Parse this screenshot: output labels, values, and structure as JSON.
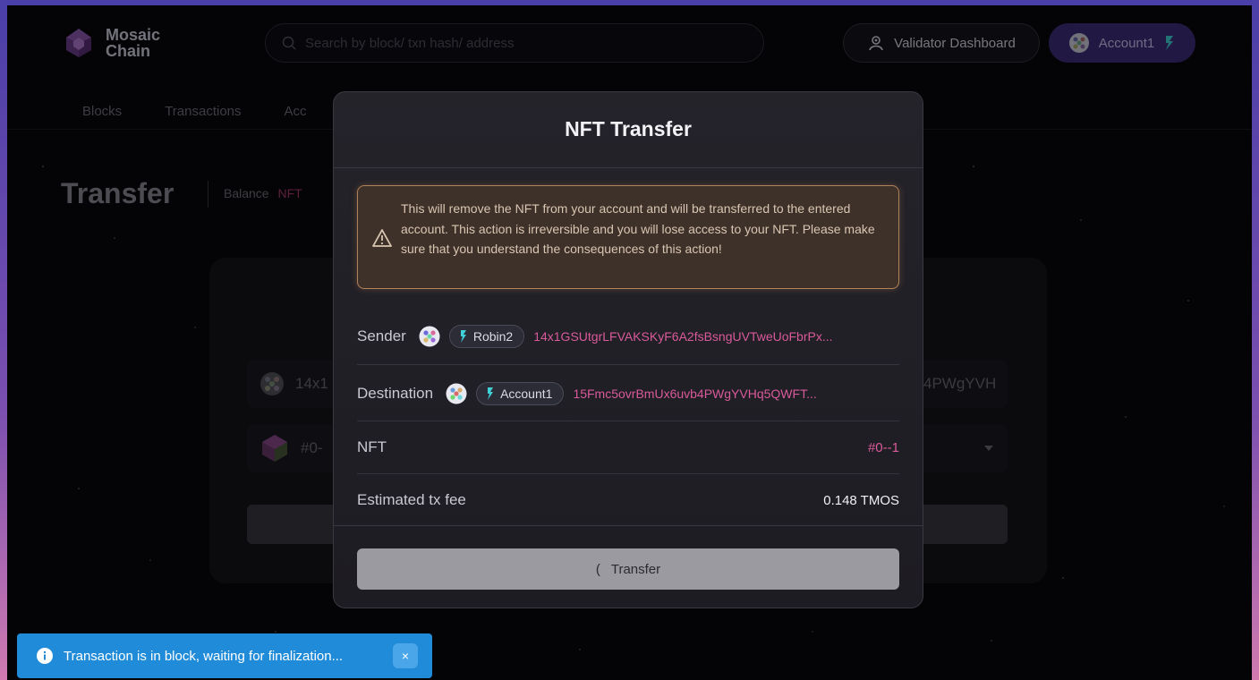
{
  "app": {
    "logo_line1": "Mosaic",
    "logo_line2": "Chain"
  },
  "header": {
    "search_placeholder": "Search by block/ txn hash/ address",
    "validator_label": "Validator Dashboard",
    "account_label": "Account1"
  },
  "nav": [
    "Blocks",
    "Transactions",
    "Acc"
  ],
  "page": {
    "title": "Transfer",
    "crumb_balance": "Balance",
    "crumb_nft": "NFT"
  },
  "background_form": {
    "address_prefix": "14x1",
    "address_suffix": "4PWgYVH",
    "nft_prefix": "#0-"
  },
  "modal": {
    "title": "NFT Transfer",
    "warning": "This will remove the NFT from your account and will be transferred to the entered account. This action is irreversible and you will lose access to your NFT. Please make sure that you understand the consequences of this action!",
    "sender_label": "Sender",
    "sender_name": "Robin2",
    "sender_address": "14x1GSUtgrLFVAKSKyF6A2fsBsngUVTweUoFbrPx...",
    "destination_label": "Destination",
    "destination_name": "Account1",
    "destination_address": "15Fmc5ovrBmUx6uvb4PWgYVHq5QWFT...",
    "nft_label": "NFT",
    "nft_value": "#0--1",
    "fee_label": "Estimated tx fee",
    "fee_value": "0.148 TMOS",
    "transfer_label": "Transfer",
    "spinner_glyph": "("
  },
  "toast": {
    "message": "Transaction is in block, waiting for finalization...",
    "close_glyph": "×"
  },
  "colors": {
    "accent_pink": "#d95a9a",
    "warning_border": "#b0825a",
    "toast_blue": "#1f8bd9",
    "account_purple": "#3c2f7a"
  }
}
